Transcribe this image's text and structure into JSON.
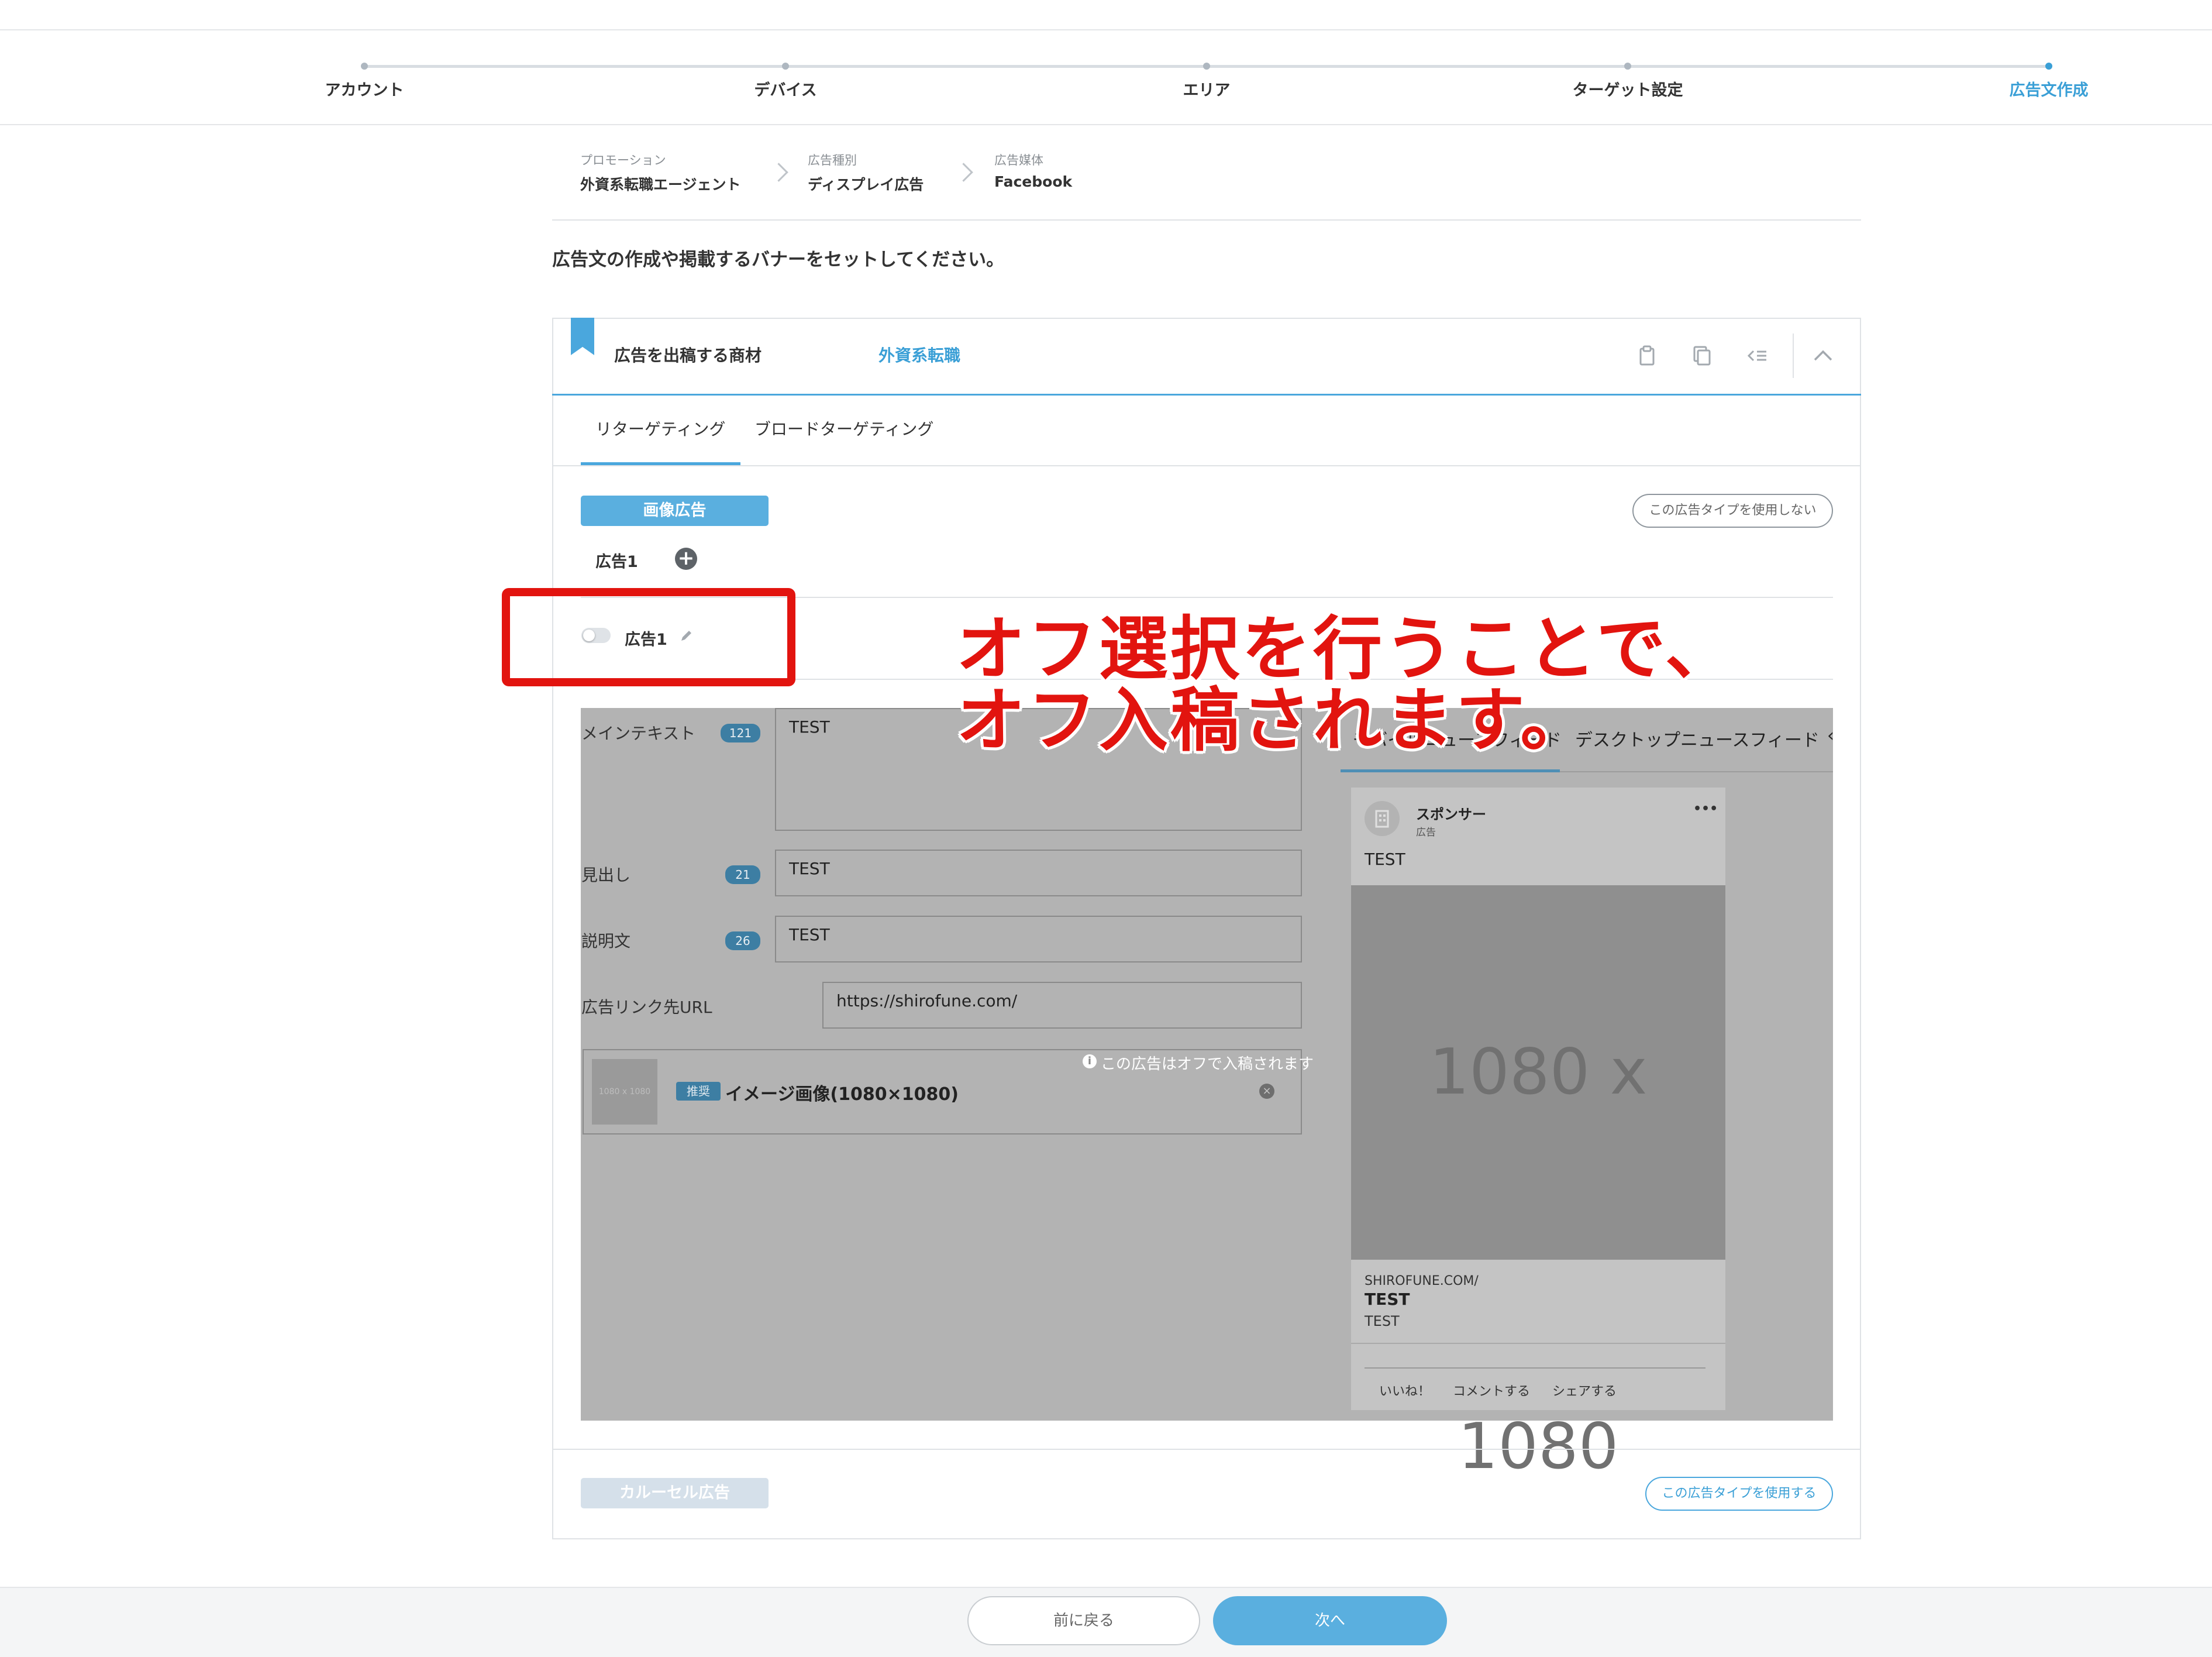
{
  "stepper": {
    "steps": [
      {
        "label": "アカウント"
      },
      {
        "label": "デバイス"
      },
      {
        "label": "エリア"
      },
      {
        "label": "ターゲット設定"
      },
      {
        "label": "広告文作成"
      }
    ],
    "active_step": 5
  },
  "breadcrumb": [
    {
      "caption": "プロモーション",
      "value": "外資系転職エージェント"
    },
    {
      "caption": "広告種別",
      "value": "ディスプレイ広告"
    },
    {
      "caption": "広告媒体",
      "value": "Facebook"
    }
  ],
  "instruction": "広告文の作成や掲載するバナーをセットしてください。",
  "card": {
    "label": "広告を出稿する商材",
    "value": "外資系転職",
    "icons": [
      "clipboard-icon",
      "copy-icon",
      "list-icon",
      "chevron-up-icon"
    ]
  },
  "tabs": [
    {
      "label": "リターゲティング",
      "active": true
    },
    {
      "label": "ブロードターゲティング",
      "active": false
    }
  ],
  "image_ad": {
    "type_label": "画像広告",
    "disable_button": "この広告タイプを使用しない",
    "ad_tab": "広告1",
    "ad_name": "広告1",
    "toggle_on": false
  },
  "form": {
    "main_text": {
      "label": "メインテキスト",
      "count": "121",
      "value": "TEST"
    },
    "headline": {
      "label": "見出し",
      "count": "21",
      "value": "TEST"
    },
    "description": {
      "label": "説明文",
      "count": "26",
      "value": "TEST"
    },
    "url": {
      "label": "広告リンク先URL",
      "value": "https://shirofune.com/"
    },
    "image": {
      "thumb_text": "1080 x 1080",
      "badge": "推奨",
      "label": "イメージ画像(1080×1080)"
    },
    "off_note": "この広告はオフで入稿されます"
  },
  "preview": {
    "tabs": [
      "モバイルニュースフィード",
      "デスクトップニュースフィード"
    ],
    "sponsor": "スポンサー",
    "sponsor_sub": "広告",
    "more": "•••",
    "text": "TEST",
    "image_text": "1080 x 1080",
    "domain": "SHIROFUNE.COM/",
    "headline": "TEST",
    "description": "TEST",
    "actions": [
      "いいね！",
      "コメントする",
      "シェアする"
    ]
  },
  "carousel": {
    "type_label": "カルーセル広告",
    "enable_button": "この広告タイプを使用する"
  },
  "annotation": {
    "line1": "オフ選択を行うことで、",
    "line2": "オフ入稿されます。"
  },
  "footer": {
    "back": "前に戻る",
    "next": "次へ"
  },
  "colors": {
    "accent": "#4aa7dd",
    "annotation": "#e2140f",
    "overlay": "#b3b3b3"
  }
}
